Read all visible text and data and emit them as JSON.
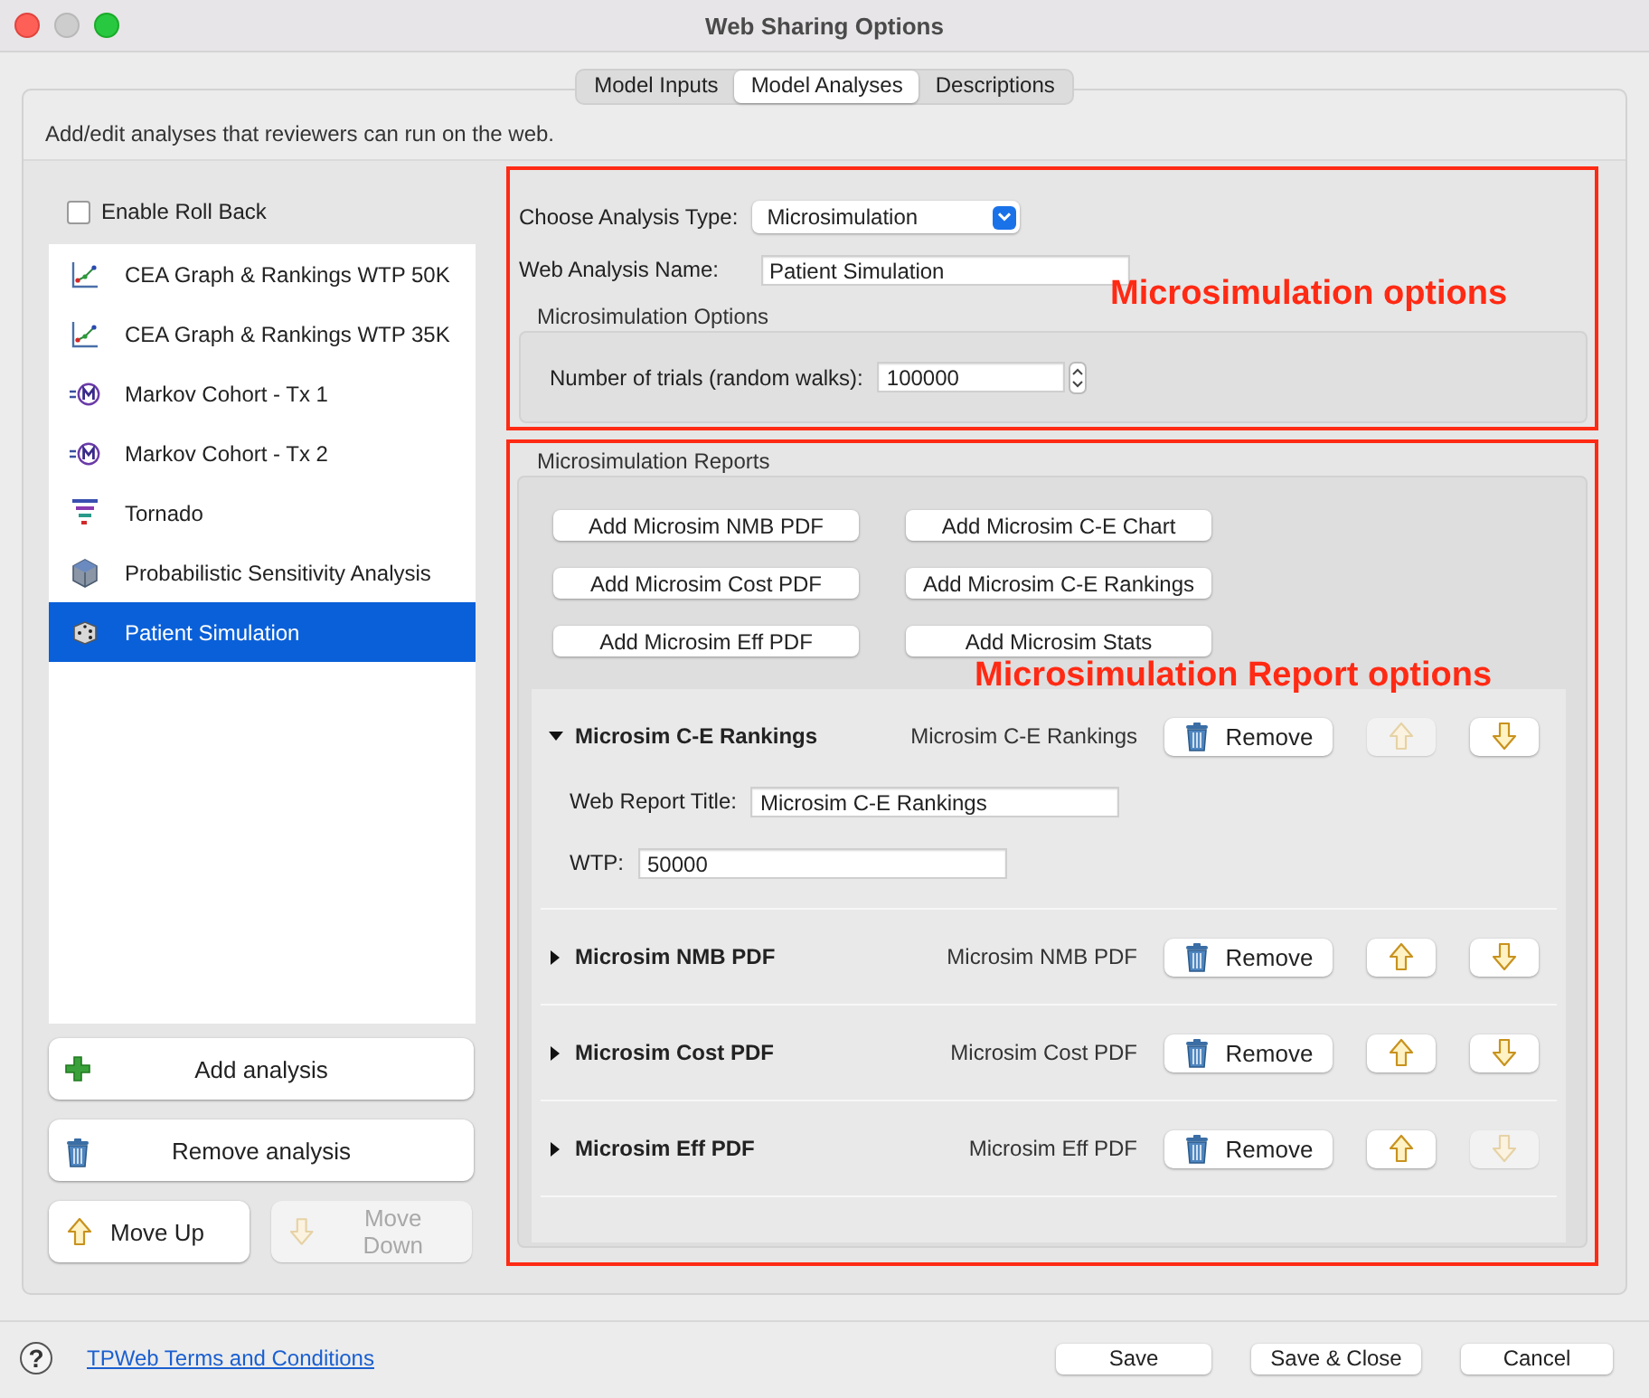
{
  "window": {
    "title": "Web Sharing Options"
  },
  "tabs": [
    {
      "label": "Model Inputs",
      "selected": false
    },
    {
      "label": "Model Analyses",
      "selected": true
    },
    {
      "label": "Descriptions",
      "selected": false
    }
  ],
  "description": "Add/edit analyses that reviewers can run on the web.",
  "roll_back": {
    "label": "Enable Roll Back",
    "checked": false
  },
  "analyses": [
    {
      "label": "CEA Graph & Rankings WTP 50K",
      "kind": "cea",
      "selected": false
    },
    {
      "label": "CEA Graph & Rankings WTP 35K",
      "kind": "cea",
      "selected": false
    },
    {
      "label": "Markov Cohort - Tx 1",
      "kind": "markov",
      "selected": false
    },
    {
      "label": "Markov Cohort - Tx 2",
      "kind": "markov",
      "selected": false
    },
    {
      "label": "Tornado",
      "kind": "tornado",
      "selected": false
    },
    {
      "label": "Probabilistic Sensitivity Analysis",
      "kind": "psa",
      "selected": false
    },
    {
      "label": "Patient Simulation",
      "kind": "simulation",
      "selected": true
    }
  ],
  "analysis_buttons": [
    {
      "label": "Add analysis",
      "kind": "add",
      "disabled": false
    },
    {
      "label": "Remove analysis",
      "kind": "remove",
      "disabled": false
    },
    {
      "label": "Move Up",
      "kind": "up",
      "disabled": false
    },
    {
      "label": "Move Down",
      "kind": "down",
      "disabled": true
    }
  ],
  "analysis_settings": {
    "type_label": "Choose Analysis Type:",
    "type_value": "Microsimulation",
    "name_label": "Web Analysis Name:",
    "name_value": "Patient Simulation"
  },
  "options_group": {
    "title": "Microsimulation Options",
    "trials_label": "Number of trials (random walks):",
    "trials_value": "100000"
  },
  "reports_group": {
    "title": "Microsimulation Reports",
    "add_buttons": [
      "Add Microsim NMB PDF",
      "Add Microsim C-E Chart",
      "Add Microsim Cost PDF",
      "Add Microsim C-E Rankings",
      "Add Microsim Eff PDF",
      "Add Microsim Stats"
    ],
    "reports": [
      {
        "title": "Microsim C-E Rankings",
        "subtitle": "Microsim C-E Rankings",
        "expanded": true,
        "remove_label": "Remove",
        "up_disabled": true,
        "down_disabled": false,
        "fields": [
          {
            "label": "Web Report Title:",
            "value": "Microsim C-E Rankings"
          },
          {
            "label": "WTP:",
            "value": "50000"
          }
        ]
      },
      {
        "title": "Microsim NMB PDF",
        "subtitle": "Microsim NMB PDF",
        "expanded": false,
        "remove_label": "Remove",
        "up_disabled": false,
        "down_disabled": false
      },
      {
        "title": "Microsim Cost PDF",
        "subtitle": "Microsim Cost PDF",
        "expanded": false,
        "remove_label": "Remove",
        "up_disabled": false,
        "down_disabled": false
      },
      {
        "title": "Microsim Eff PDF",
        "subtitle": "Microsim Eff PDF",
        "expanded": false,
        "remove_label": "Remove",
        "up_disabled": false,
        "down_disabled": true
      }
    ]
  },
  "annotations": [
    {
      "label": "Microsimulation options"
    },
    {
      "label": "Microsimulation Report options"
    }
  ],
  "footer": {
    "help": "?",
    "link": "TPWeb Terms and Conditions",
    "buttons": [
      "Save",
      "Save & Close",
      "Cancel"
    ]
  }
}
